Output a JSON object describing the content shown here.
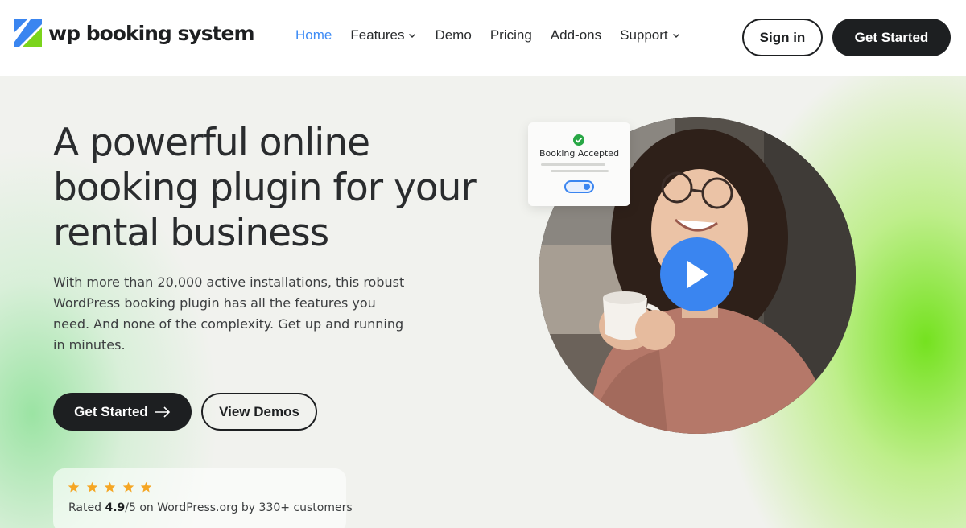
{
  "header": {
    "brand": "wp booking system",
    "nav": [
      {
        "label": "Home",
        "active": true,
        "dropdown": false
      },
      {
        "label": "Features",
        "active": false,
        "dropdown": true
      },
      {
        "label": "Demo",
        "active": false,
        "dropdown": false
      },
      {
        "label": "Pricing",
        "active": false,
        "dropdown": false
      },
      {
        "label": "Add-ons",
        "active": false,
        "dropdown": false
      },
      {
        "label": "Support",
        "active": false,
        "dropdown": true
      }
    ],
    "signin_label": "Sign in",
    "get_started_label": "Get Started"
  },
  "hero": {
    "headline": "A powerful online booking plugin for your rental business",
    "subtext": "With more than 20,000 active installations, this robust WordPress booking plugin has all the features you need. And none of the complexity. Get up and running in minutes.",
    "primary_button": "Get Started",
    "secondary_button": "View Demos",
    "rating": {
      "stars": 5,
      "prefix": "Rated",
      "score": "4.9",
      "suffix": "/5 on WordPress.org by 330+ customers"
    },
    "booking_card": {
      "label": "Booking Accepted"
    }
  },
  "colors": {
    "accent": "#3f8cf5",
    "dark": "#1d1f21",
    "star": "#f5a623",
    "brand_green": "#7bd41c",
    "brand_blue": "#3a85f0"
  }
}
